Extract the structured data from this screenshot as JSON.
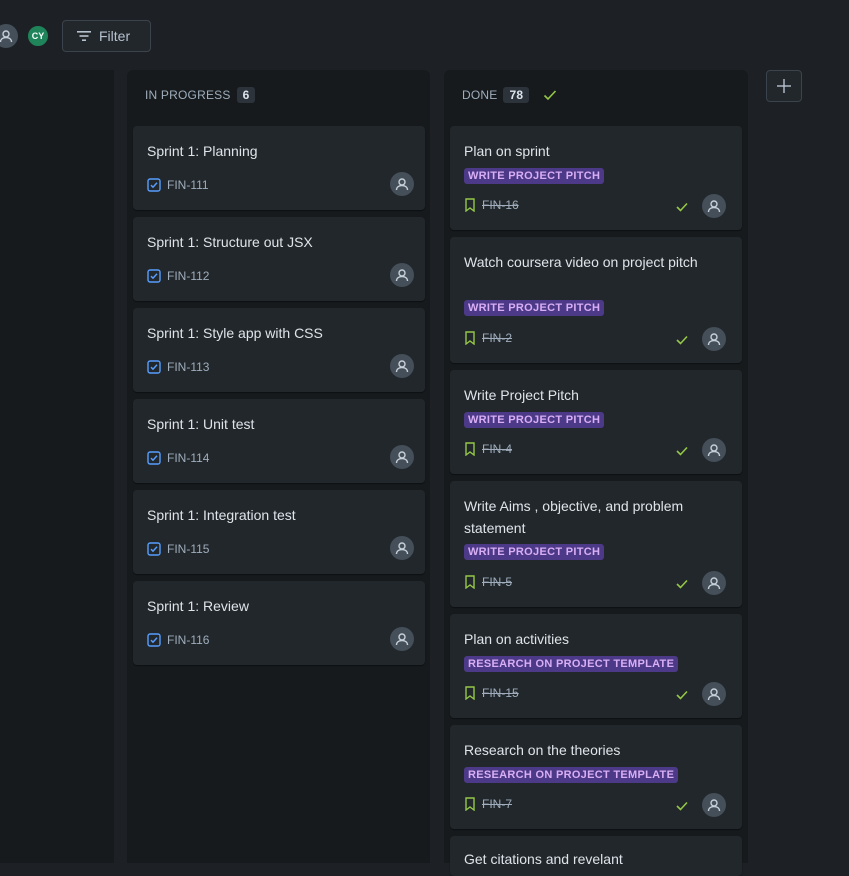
{
  "toolbar": {
    "avatar_initials": "CY",
    "filter_label": "Filter"
  },
  "columns": [
    {
      "name": "IN PROGRESS",
      "count": "6",
      "cards": [
        {
          "title": "Sprint 1: Planning",
          "key": "FIN-111",
          "icon": "checkbox-icon"
        },
        {
          "title": "Sprint 1: Structure out JSX",
          "key": "FIN-112",
          "icon": "checkbox-icon"
        },
        {
          "title": "Sprint 1: Style app with CSS",
          "key": "FIN-113",
          "icon": "checkbox-icon"
        },
        {
          "title": "Sprint 1: Unit test",
          "key": "FIN-114",
          "icon": "checkbox-icon"
        },
        {
          "title": "Sprint 1: Integration test",
          "key": "FIN-115",
          "icon": "checkbox-icon"
        },
        {
          "title": "Sprint 1: Review",
          "key": "FIN-116",
          "icon": "checkbox-icon"
        }
      ]
    },
    {
      "name": "DONE",
      "count": "78",
      "cards": [
        {
          "title": "Plan on sprint",
          "epic": "WRITE PROJECT PITCH",
          "key": "FIN-16",
          "icon": "bookmark-icon"
        },
        {
          "title": "Watch coursera video on project pitch",
          "epic": "WRITE PROJECT PITCH",
          "key": "FIN-2",
          "icon": "bookmark-icon"
        },
        {
          "title": "Write Project Pitch",
          "epic": "WRITE PROJECT PITCH",
          "key": "FIN-4",
          "icon": "bookmark-icon"
        },
        {
          "title": "Write Aims , objective, and problem statement",
          "epic": "WRITE PROJECT PITCH",
          "key": "FIN-5",
          "icon": "bookmark-icon"
        },
        {
          "title": "Plan on activities",
          "epic": "RESEARCH ON PROJECT TEMPLATE",
          "key": "FIN-15",
          "icon": "bookmark-icon"
        },
        {
          "title": "Research on the theories",
          "epic": "RESEARCH ON PROJECT TEMPLATE",
          "key": "FIN-7",
          "icon": "bookmark-icon"
        },
        {
          "title": "Get citations and revelant"
        }
      ]
    }
  ],
  "colors": {
    "background": "#1d2125",
    "column": "#161a1d",
    "card": "#22272b",
    "accent_blue": "#579dff",
    "accent_green": "#94c748",
    "epic_purple": "#4f3a8c"
  }
}
